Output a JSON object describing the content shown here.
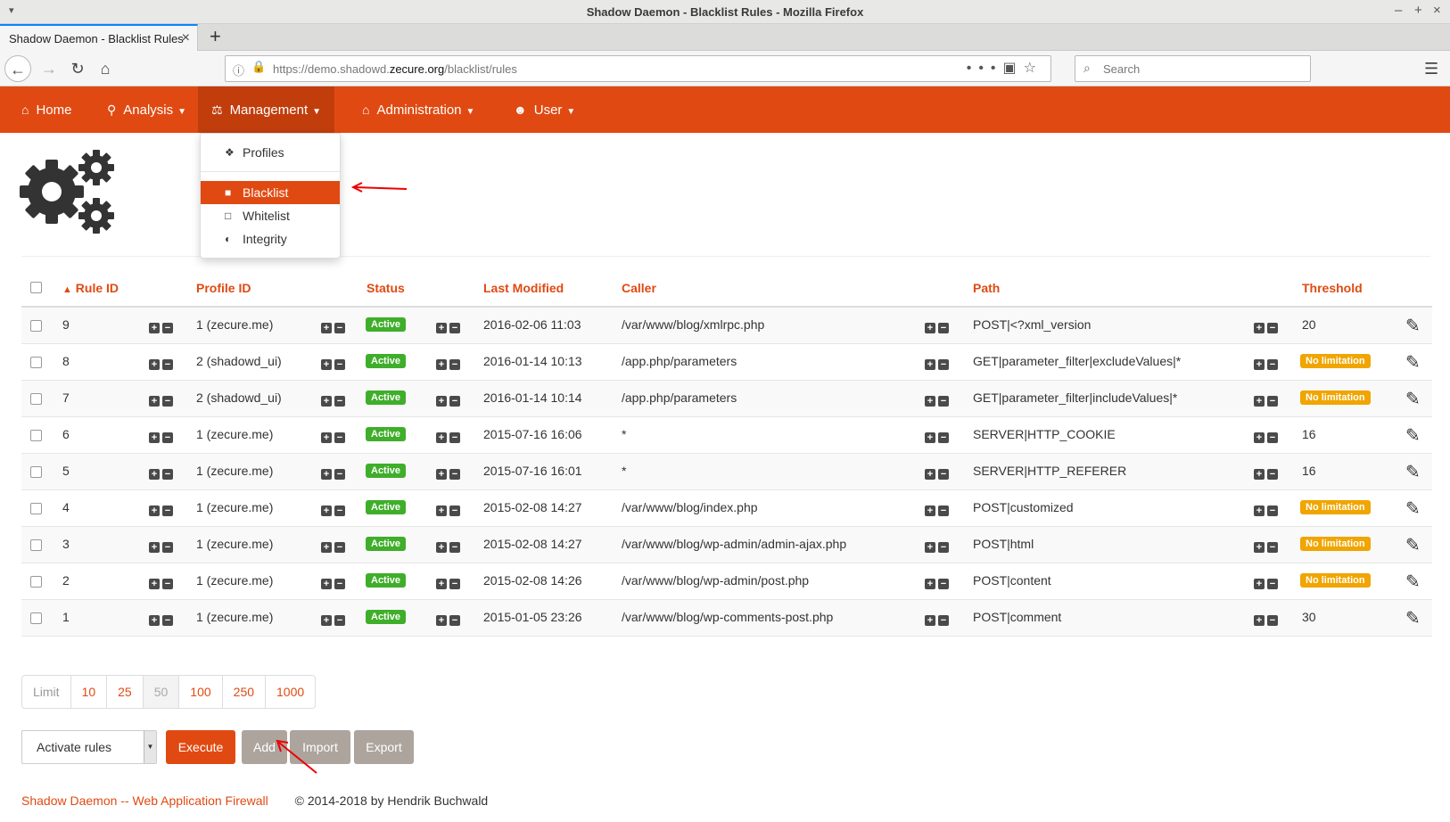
{
  "browser": {
    "window_title": "Shadow Daemon - Blacklist Rules - Mozilla Firefox",
    "tab_title": "Shadow Daemon - Blacklist Rules",
    "url_prefix": "https://demo.shadowd.",
    "url_domain": "zecure.org",
    "url_path": "/blacklist/rules",
    "search_placeholder": "Search"
  },
  "nav": {
    "home": "Home",
    "analysis": "Analysis",
    "management": "Management",
    "administration": "Administration",
    "user": "User"
  },
  "dropdown": {
    "profiles": "Profiles",
    "blacklist": "Blacklist",
    "whitelist": "Whitelist",
    "integrity": "Integrity"
  },
  "table": {
    "headers": {
      "rule_id": "Rule ID",
      "profile_id": "Profile ID",
      "status": "Status",
      "last_modified": "Last Modified",
      "caller": "Caller",
      "path": "Path",
      "threshold": "Threshold"
    },
    "sort_indicator": "▲",
    "status_label": "Active",
    "no_limitation_label": "No limitation",
    "rows": [
      {
        "id": "9",
        "profile": "1 (zecure.me)",
        "modified": "2016-02-06 11:03",
        "caller": "/var/www/blog/xmlrpc.php",
        "path": "POST|<?xml_version",
        "threshold": "20"
      },
      {
        "id": "8",
        "profile": "2 (shadowd_ui)",
        "modified": "2016-01-14 10:13",
        "caller": "/app.php/parameters",
        "path": "GET|parameter_filter|excludeValues|*",
        "threshold": "No limitation"
      },
      {
        "id": "7",
        "profile": "2 (shadowd_ui)",
        "modified": "2016-01-14 10:14",
        "caller": "/app.php/parameters",
        "path": "GET|parameter_filter|includeValues|*",
        "threshold": "No limitation"
      },
      {
        "id": "6",
        "profile": "1 (zecure.me)",
        "modified": "2015-07-16 16:06",
        "caller": "*",
        "path": "SERVER|HTTP_COOKIE",
        "threshold": "16"
      },
      {
        "id": "5",
        "profile": "1 (zecure.me)",
        "modified": "2015-07-16 16:01",
        "caller": "*",
        "path": "SERVER|HTTP_REFERER",
        "threshold": "16"
      },
      {
        "id": "4",
        "profile": "1 (zecure.me)",
        "modified": "2015-02-08 14:27",
        "caller": "/var/www/blog/index.php",
        "path": "POST|customized",
        "threshold": "No limitation"
      },
      {
        "id": "3",
        "profile": "1 (zecure.me)",
        "modified": "2015-02-08 14:27",
        "caller": "/var/www/blog/wp-admin/admin-ajax.php",
        "path": "POST|html",
        "threshold": "No limitation"
      },
      {
        "id": "2",
        "profile": "1 (zecure.me)",
        "modified": "2015-02-08 14:26",
        "caller": "/var/www/blog/wp-admin/post.php",
        "path": "POST|content",
        "threshold": "No limitation"
      },
      {
        "id": "1",
        "profile": "1 (zecure.me)",
        "modified": "2015-01-05 23:26",
        "caller": "/var/www/blog/wp-comments-post.php",
        "path": "POST|comment",
        "threshold": "30"
      }
    ]
  },
  "pagination": {
    "label": "Limit",
    "options": [
      "10",
      "25",
      "50",
      "100",
      "250",
      "1000"
    ],
    "current": "50"
  },
  "actions": {
    "select_value": "Activate rules",
    "execute": "Execute",
    "add": "Add",
    "import": "Import",
    "export": "Export"
  },
  "footer": {
    "link": "Shadow Daemon -- Web Application Firewall",
    "copyright": "© 2014-2018 by Hendrik Buchwald"
  },
  "colors": {
    "brand": "#e04a12",
    "brand_dark": "#c23d0c",
    "active_badge": "#3fae2a",
    "no_limit_badge": "#f0a500",
    "secondary_button": "#aca49d"
  }
}
